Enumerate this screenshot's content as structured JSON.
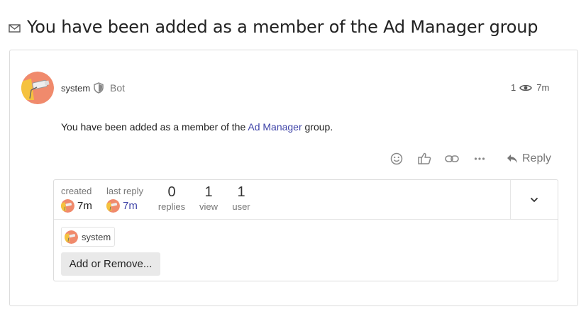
{
  "topic": {
    "title": "You have been added as a member of the Ad Manager group"
  },
  "post": {
    "username": "system",
    "user_title": "Bot",
    "views": "1",
    "age": "7m",
    "body_prefix": "You have been added as a member of the ",
    "body_link": "Ad Manager",
    "body_suffix": " group.",
    "reply_label": "Reply"
  },
  "icons": {
    "topic": "envelope-icon",
    "title_flair": "shield-icon",
    "views": "eye-icon",
    "reactions": [
      "smiley-icon",
      "thumbs-up-icon",
      "link-icon",
      "ellipsis-icon"
    ],
    "reply": "reply-arrow-icon",
    "expand": "chevron-down-icon"
  },
  "topic_map": {
    "created_label": "created",
    "created_value": "7m",
    "last_reply_label": "last reply",
    "last_reply_value": "7m",
    "replies_count": "0",
    "replies_label": "replies",
    "views_count": "1",
    "views_label": "view",
    "users_count": "1",
    "users_label": "user",
    "participant_name": "system",
    "add_remove_label": "Add or Remove..."
  },
  "colors": {
    "link": "#3f44a8",
    "avatar_bg": "#f08a6c",
    "avatar_accent": "#f5c23e"
  }
}
